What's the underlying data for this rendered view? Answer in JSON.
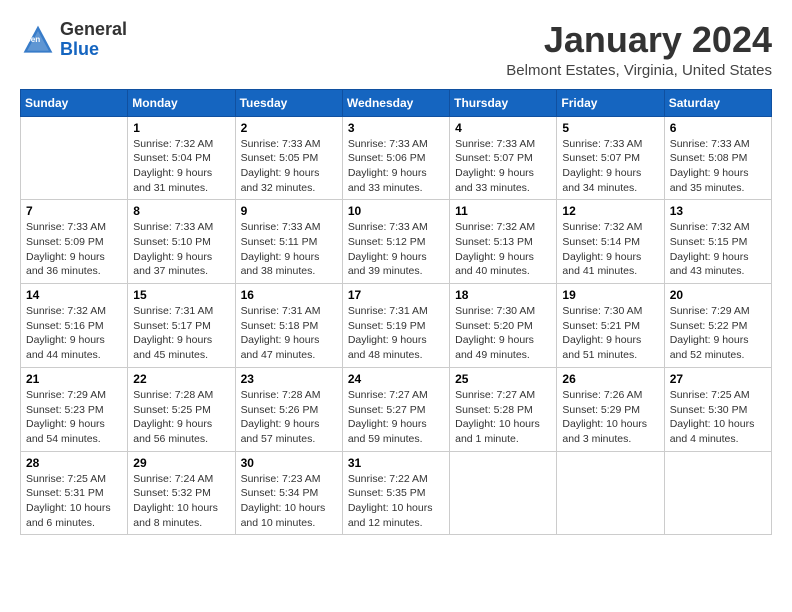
{
  "header": {
    "logo_general": "General",
    "logo_blue": "Blue",
    "month": "January 2024",
    "location": "Belmont Estates, Virginia, United States"
  },
  "days_of_week": [
    "Sunday",
    "Monday",
    "Tuesday",
    "Wednesday",
    "Thursday",
    "Friday",
    "Saturday"
  ],
  "weeks": [
    [
      {
        "day": "",
        "info": ""
      },
      {
        "day": "1",
        "info": "Sunrise: 7:32 AM\nSunset: 5:04 PM\nDaylight: 9 hours\nand 31 minutes."
      },
      {
        "day": "2",
        "info": "Sunrise: 7:33 AM\nSunset: 5:05 PM\nDaylight: 9 hours\nand 32 minutes."
      },
      {
        "day": "3",
        "info": "Sunrise: 7:33 AM\nSunset: 5:06 PM\nDaylight: 9 hours\nand 33 minutes."
      },
      {
        "day": "4",
        "info": "Sunrise: 7:33 AM\nSunset: 5:07 PM\nDaylight: 9 hours\nand 33 minutes."
      },
      {
        "day": "5",
        "info": "Sunrise: 7:33 AM\nSunset: 5:07 PM\nDaylight: 9 hours\nand 34 minutes."
      },
      {
        "day": "6",
        "info": "Sunrise: 7:33 AM\nSunset: 5:08 PM\nDaylight: 9 hours\nand 35 minutes."
      }
    ],
    [
      {
        "day": "7",
        "info": "Sunrise: 7:33 AM\nSunset: 5:09 PM\nDaylight: 9 hours\nand 36 minutes."
      },
      {
        "day": "8",
        "info": "Sunrise: 7:33 AM\nSunset: 5:10 PM\nDaylight: 9 hours\nand 37 minutes."
      },
      {
        "day": "9",
        "info": "Sunrise: 7:33 AM\nSunset: 5:11 PM\nDaylight: 9 hours\nand 38 minutes."
      },
      {
        "day": "10",
        "info": "Sunrise: 7:33 AM\nSunset: 5:12 PM\nDaylight: 9 hours\nand 39 minutes."
      },
      {
        "day": "11",
        "info": "Sunrise: 7:32 AM\nSunset: 5:13 PM\nDaylight: 9 hours\nand 40 minutes."
      },
      {
        "day": "12",
        "info": "Sunrise: 7:32 AM\nSunset: 5:14 PM\nDaylight: 9 hours\nand 41 minutes."
      },
      {
        "day": "13",
        "info": "Sunrise: 7:32 AM\nSunset: 5:15 PM\nDaylight: 9 hours\nand 43 minutes."
      }
    ],
    [
      {
        "day": "14",
        "info": "Sunrise: 7:32 AM\nSunset: 5:16 PM\nDaylight: 9 hours\nand 44 minutes."
      },
      {
        "day": "15",
        "info": "Sunrise: 7:31 AM\nSunset: 5:17 PM\nDaylight: 9 hours\nand 45 minutes."
      },
      {
        "day": "16",
        "info": "Sunrise: 7:31 AM\nSunset: 5:18 PM\nDaylight: 9 hours\nand 47 minutes."
      },
      {
        "day": "17",
        "info": "Sunrise: 7:31 AM\nSunset: 5:19 PM\nDaylight: 9 hours\nand 48 minutes."
      },
      {
        "day": "18",
        "info": "Sunrise: 7:30 AM\nSunset: 5:20 PM\nDaylight: 9 hours\nand 49 minutes."
      },
      {
        "day": "19",
        "info": "Sunrise: 7:30 AM\nSunset: 5:21 PM\nDaylight: 9 hours\nand 51 minutes."
      },
      {
        "day": "20",
        "info": "Sunrise: 7:29 AM\nSunset: 5:22 PM\nDaylight: 9 hours\nand 52 minutes."
      }
    ],
    [
      {
        "day": "21",
        "info": "Sunrise: 7:29 AM\nSunset: 5:23 PM\nDaylight: 9 hours\nand 54 minutes."
      },
      {
        "day": "22",
        "info": "Sunrise: 7:28 AM\nSunset: 5:25 PM\nDaylight: 9 hours\nand 56 minutes."
      },
      {
        "day": "23",
        "info": "Sunrise: 7:28 AM\nSunset: 5:26 PM\nDaylight: 9 hours\nand 57 minutes."
      },
      {
        "day": "24",
        "info": "Sunrise: 7:27 AM\nSunset: 5:27 PM\nDaylight: 9 hours\nand 59 minutes."
      },
      {
        "day": "25",
        "info": "Sunrise: 7:27 AM\nSunset: 5:28 PM\nDaylight: 10 hours\nand 1 minute."
      },
      {
        "day": "26",
        "info": "Sunrise: 7:26 AM\nSunset: 5:29 PM\nDaylight: 10 hours\nand 3 minutes."
      },
      {
        "day": "27",
        "info": "Sunrise: 7:25 AM\nSunset: 5:30 PM\nDaylight: 10 hours\nand 4 minutes."
      }
    ],
    [
      {
        "day": "28",
        "info": "Sunrise: 7:25 AM\nSunset: 5:31 PM\nDaylight: 10 hours\nand 6 minutes."
      },
      {
        "day": "29",
        "info": "Sunrise: 7:24 AM\nSunset: 5:32 PM\nDaylight: 10 hours\nand 8 minutes."
      },
      {
        "day": "30",
        "info": "Sunrise: 7:23 AM\nSunset: 5:34 PM\nDaylight: 10 hours\nand 10 minutes."
      },
      {
        "day": "31",
        "info": "Sunrise: 7:22 AM\nSunset: 5:35 PM\nDaylight: 10 hours\nand 12 minutes."
      },
      {
        "day": "",
        "info": ""
      },
      {
        "day": "",
        "info": ""
      },
      {
        "day": "",
        "info": ""
      }
    ]
  ]
}
